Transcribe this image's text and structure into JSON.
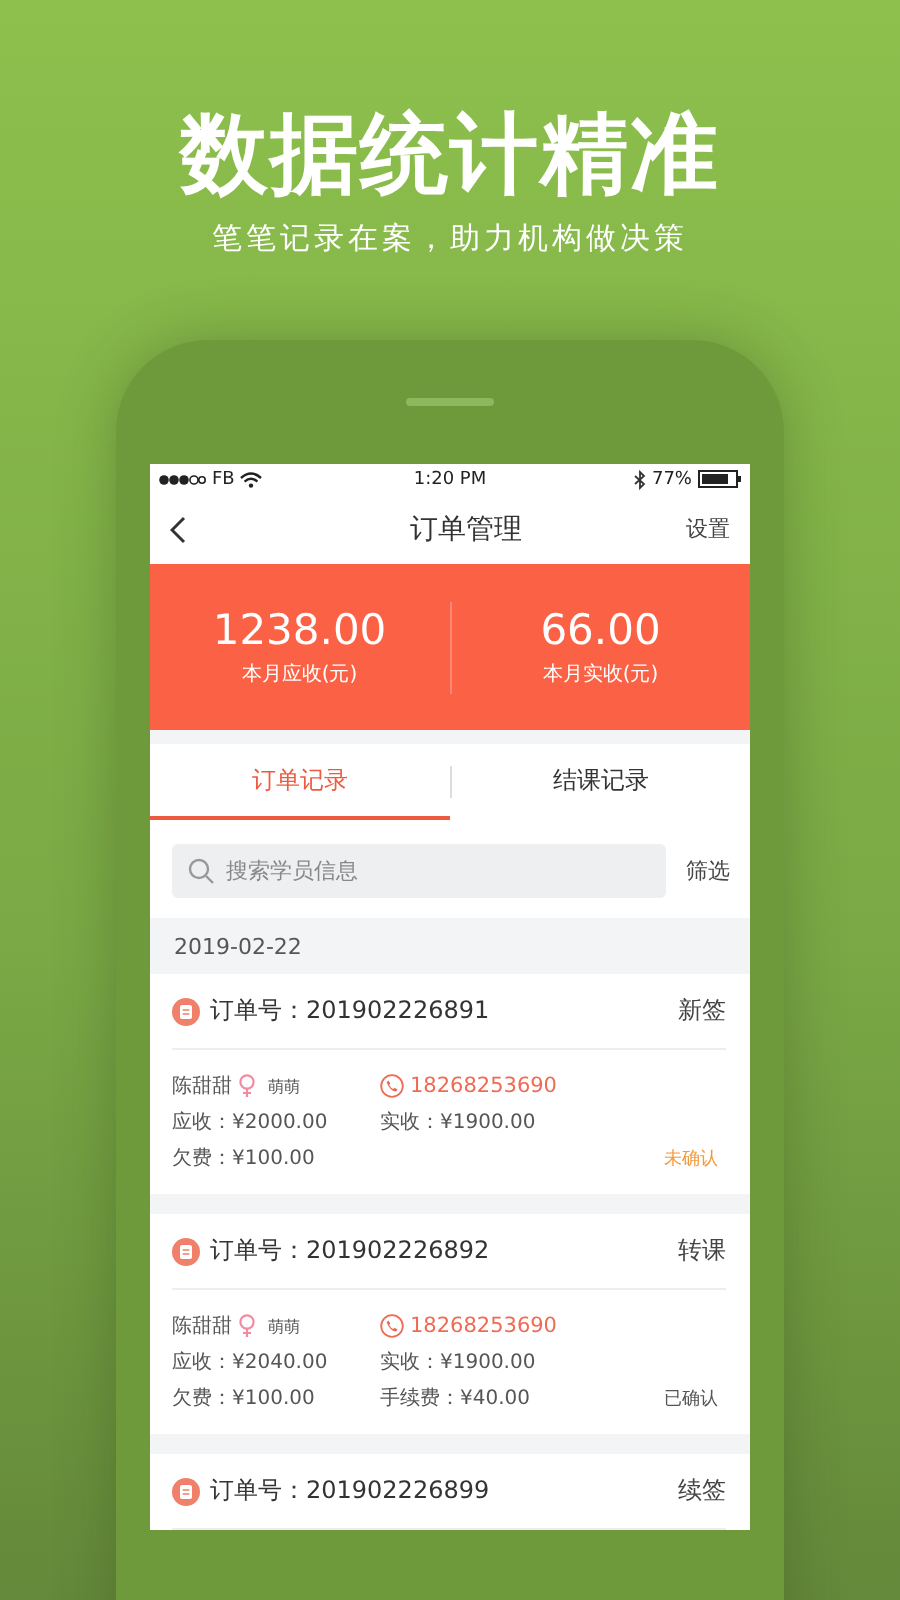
{
  "headline": "数据统计精准",
  "subtitle": "笔笔记录在案，助力机构做决策",
  "status_bar": {
    "carrier": "FB",
    "time": "1:20 PM",
    "battery": "77%"
  },
  "nav": {
    "title": "订单管理",
    "action": "设置"
  },
  "summary": [
    {
      "value": "1238.00",
      "label": "本月应收(元)"
    },
    {
      "value": "66.00",
      "label": "本月实收(元)"
    }
  ],
  "tabs": [
    {
      "label": "订单记录",
      "selected": true
    },
    {
      "label": "结课记录",
      "selected": false
    }
  ],
  "search": {
    "placeholder": "搜索学员信息"
  },
  "filter": "筛选",
  "date": "2019-02-22",
  "orders": [
    {
      "order_no": "订单号：201902226891",
      "type": "新签",
      "name": "陈甜甜",
      "nickname": "萌萌",
      "phone": "18268253690",
      "receivable": "应收：¥2000.00",
      "received": "实收：¥1900.00",
      "arrears": "欠费：¥100.00",
      "status": "未确认",
      "confirmed": false
    },
    {
      "order_no": "订单号：201902226892",
      "type": "转课",
      "name": "陈甜甜",
      "nickname": "萌萌",
      "phone": "18268253690",
      "receivable": "应收：¥2040.00",
      "received": "实收：¥1900.00",
      "arrears": "欠费：¥100.00",
      "fee": "手续费：¥40.00",
      "status": "已确认",
      "confirmed": true
    },
    {
      "order_no": "订单号：201902226899",
      "type": "续签"
    }
  ]
}
